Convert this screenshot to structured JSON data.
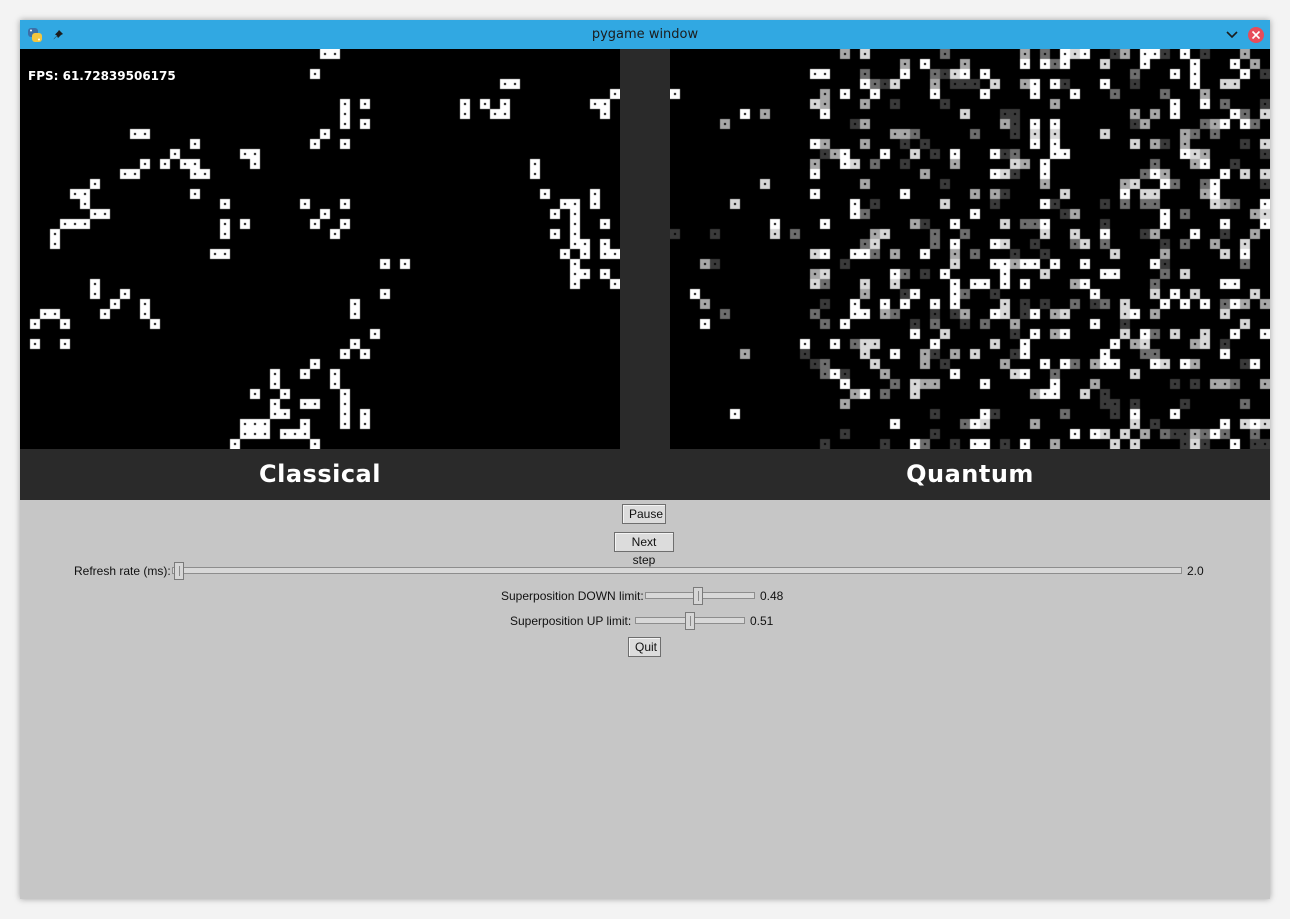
{
  "window": {
    "title": "pygame window",
    "icons": [
      "python-logo-icon",
      "pin-icon",
      "chevron-down-icon",
      "close-icon"
    ],
    "titlebar_color": "#31a8e2",
    "close_color": "#e74c5a"
  },
  "game": {
    "fps_text": "FPS: 61.72839506175",
    "classical_label": "Classical",
    "quantum_label": "Quantum",
    "cell_alive_color": "#ffffff",
    "cell_dead_color": "#000000"
  },
  "controls": {
    "pause_label": "Pause",
    "next_step_label": "Next step",
    "quit_label": "Quit",
    "refresh": {
      "label": "Refresh rate (ms):",
      "value": "2.0",
      "min": 1,
      "max": 1000
    },
    "down_limit": {
      "label": "Superposition DOWN limit:",
      "value": "0.48"
    },
    "up_limit": {
      "label": "Superposition UP limit:",
      "value": "0.51"
    }
  }
}
